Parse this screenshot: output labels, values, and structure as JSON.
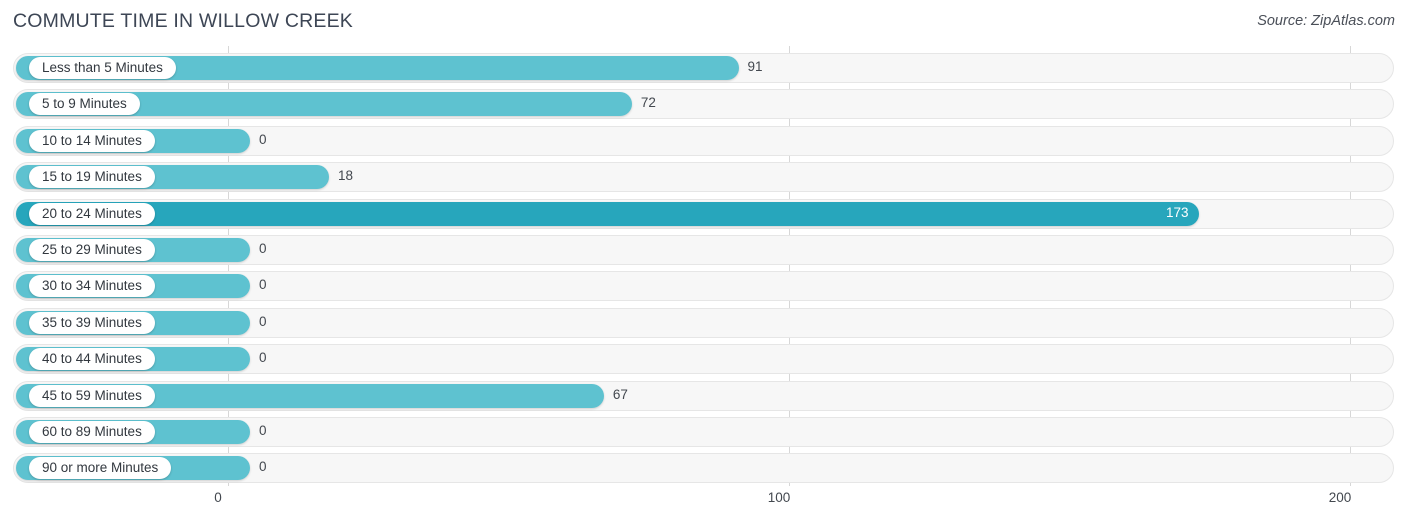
{
  "header": {
    "title": "COMMUTE TIME IN WILLOW CREEK",
    "source": "Source: ZipAtlas.com"
  },
  "colors": {
    "bar": "#5ec2d0",
    "bar_highlight": "#27a6bc",
    "track": "#f7f7f7",
    "gridline": "#d7d7d7",
    "label_text": "#32383f",
    "value_text": "#43484f"
  },
  "chart_data": {
    "type": "bar",
    "orientation": "horizontal",
    "title": "COMMUTE TIME IN WILLOW CREEK",
    "xlabel": "",
    "ylabel": "",
    "xlim": [
      0,
      200
    ],
    "grid": true,
    "legend": false,
    "xticks": [
      "0",
      "100",
      "200"
    ],
    "xtick_values": [
      0,
      100,
      200
    ],
    "categories": [
      "Less than 5 Minutes",
      "5 to 9 Minutes",
      "10 to 14 Minutes",
      "15 to 19 Minutes",
      "20 to 24 Minutes",
      "25 to 29 Minutes",
      "30 to 34 Minutes",
      "35 to 39 Minutes",
      "40 to 44 Minutes",
      "45 to 59 Minutes",
      "60 to 89 Minutes",
      "90 or more Minutes"
    ],
    "values": [
      91,
      72,
      0,
      18,
      173,
      0,
      0,
      0,
      0,
      67,
      0,
      0
    ],
    "value_labels": [
      "91",
      "72",
      "0",
      "18",
      "173",
      "0",
      "0",
      "0",
      "0",
      "67",
      "0",
      "0"
    ],
    "highlight_index": 4
  }
}
